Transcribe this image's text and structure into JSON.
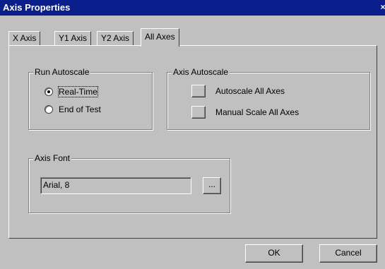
{
  "window": {
    "title": "Axis Properties",
    "close_glyph": "×"
  },
  "tabs": [
    {
      "label": "X Axis"
    },
    {
      "label": "Y1 Axis"
    },
    {
      "label": "Y2 Axis"
    },
    {
      "label": "All Axes",
      "active": true
    }
  ],
  "run_autoscale": {
    "legend": "Run Autoscale",
    "options": [
      {
        "label": "Real-Time",
        "selected": true
      },
      {
        "label": "End of Test",
        "selected": false
      }
    ]
  },
  "axis_autoscale": {
    "legend": "Axis Autoscale",
    "autoscale_all_label": "Autoscale All Axes",
    "manual_scale_all_label": "Manual Scale All Axes"
  },
  "axis_font": {
    "legend": "Axis Font",
    "value": "Arial, 8",
    "browse_label": "..."
  },
  "buttons": {
    "ok": "OK",
    "cancel": "Cancel"
  }
}
